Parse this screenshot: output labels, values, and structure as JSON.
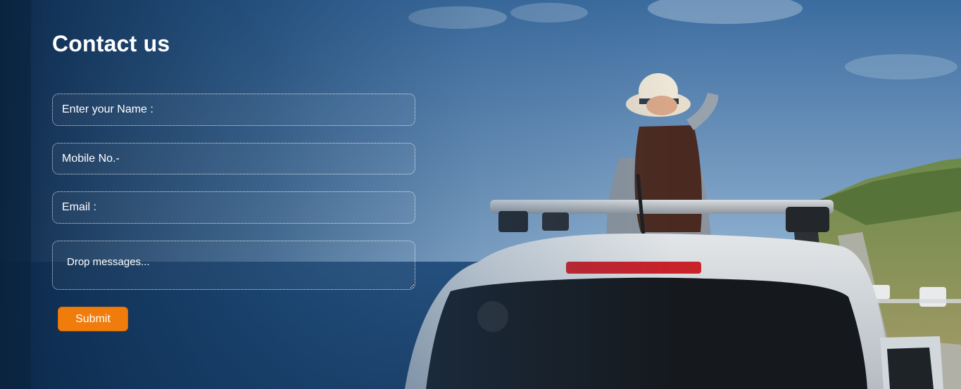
{
  "contact": {
    "title": "Contact us",
    "fields": {
      "name_placeholder": "Enter your Name :",
      "mobile_placeholder": "Mobile No.-",
      "email_placeholder": "Email :",
      "message_placeholder": "Drop messages..."
    },
    "submit_label": "Submit"
  },
  "colors": {
    "accent": "#f07c0c",
    "overlay": "#0d2c4f",
    "text": "#ffffff"
  }
}
